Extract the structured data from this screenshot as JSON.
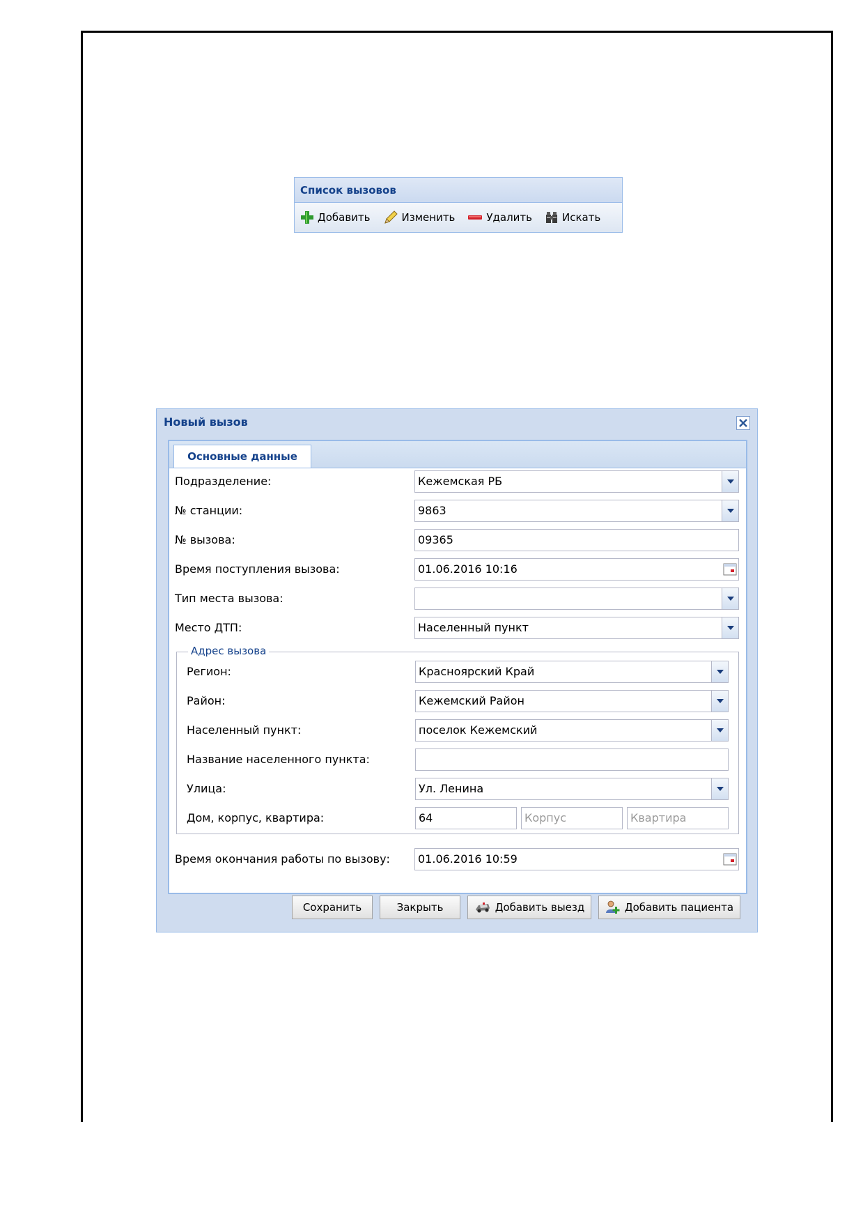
{
  "list_panel": {
    "title": "Список вызовов",
    "toolbar": {
      "add": "Добавить",
      "edit": "Изменить",
      "delete": "Удалить",
      "search": "Искать"
    }
  },
  "dialog": {
    "title": "Новый вызов",
    "tab": "Основные данные",
    "fields": {
      "division_label": "Подразделение:",
      "division_value": "Кежемская РБ",
      "station_label": "№ станции:",
      "station_value": "9863",
      "call_no_label": "№ вызова:",
      "call_no_value": "09365",
      "receipt_time_label": "Время поступления вызова:",
      "receipt_time_value": "01.06.2016 10:16",
      "place_type_label": "Тип места вызова:",
      "place_type_value": "",
      "accident_place_label": "Место ДТП:",
      "accident_place_value": "Населенный пункт"
    },
    "address": {
      "legend": "Адрес вызова",
      "region_label": "Регион:",
      "region_value": "Красноярский Край",
      "district_label": "Район:",
      "district_value": "Кежемский Район",
      "locality_label": "Населенный пункт:",
      "locality_value": "поселок Кежемский",
      "locality_name_label": "Название населенного пункта:",
      "locality_name_value": "",
      "street_label": "Улица:",
      "street_value": "Ул. Ленина",
      "house_label": "Дом, корпус, квартира:",
      "house_value": "64",
      "building_placeholder": "Корпус",
      "apartment_placeholder": "Квартира"
    },
    "end_time_label": "Время окончания работы по вызову:",
    "end_time_value": "01.06.2016 10:59",
    "buttons": {
      "save": "Сохранить",
      "close": "Закрыть",
      "add_departure": "Добавить выезд",
      "add_patient": "Добавить пациента"
    }
  },
  "colors": {
    "panel_title": "#15428b",
    "panel_border": "#99bbe8",
    "window_bg": "#cfdcef"
  }
}
